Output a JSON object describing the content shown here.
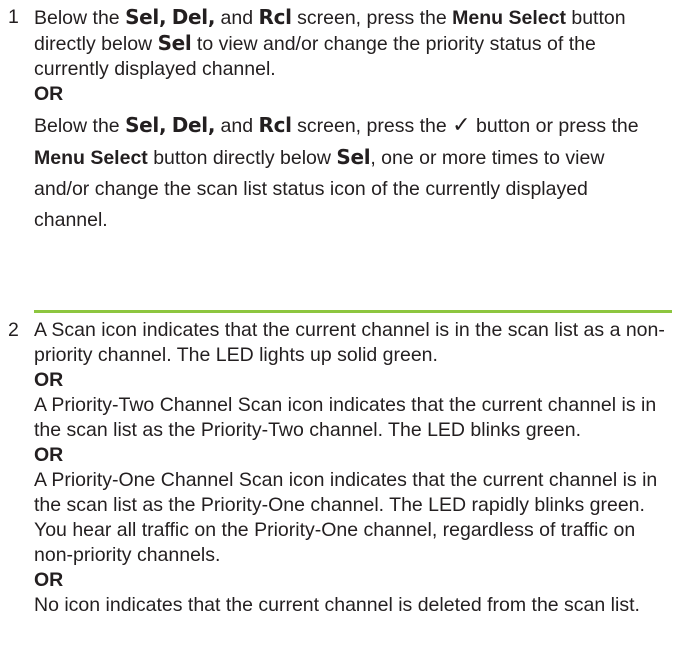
{
  "step1": {
    "number": "1",
    "para1": {
      "t1": "Below the ",
      "sel": "Sel,",
      "t2": " ",
      "del": "Del,",
      "t3": " and ",
      "rcl": "Rcl",
      "t4": " screen, press the ",
      "menu_select": "Menu Select",
      "t5": " button directly below ",
      "sel2": "Sel",
      "t6": " to view and/or change the priority status of the currently displayed channel."
    },
    "or": "OR",
    "para2": {
      "t1": "Below the ",
      "sel": "Sel,",
      "t2": " ",
      "del": "Del,",
      "t3": " and ",
      "rcl": "Rcl",
      "t4": " screen, press the ",
      "check": "✓",
      "t5": " button or press the ",
      "menu_select": "Menu Select",
      "t6": " button directly below ",
      "sel2": "Sel",
      "t7": ", one or more times to view and/or change the scan list status icon of the currently displayed channel."
    }
  },
  "step2": {
    "number": "2",
    "para1": "A Scan icon indicates that the current channel is in the scan list as a non-priority channel. The LED lights up solid green.",
    "or1": "OR",
    "para2": "A Priority-Two Channel Scan icon indicates that the current channel is in the scan list as the Priority-Two channel. The LED blinks green.",
    "or2": "OR",
    "para3": "A Priority-One Channel Scan icon indicates that the current channel is in the scan list as the Priority-One channel. The LED rapidly blinks green. You hear all traffic on the Priority-One channel, regardless of traffic on non-priority channels.",
    "or3": "OR",
    "para4": "No icon indicates that the current channel is deleted from the scan list."
  },
  "colors": {
    "separator": "#8dc63f",
    "text": "#231f20"
  }
}
